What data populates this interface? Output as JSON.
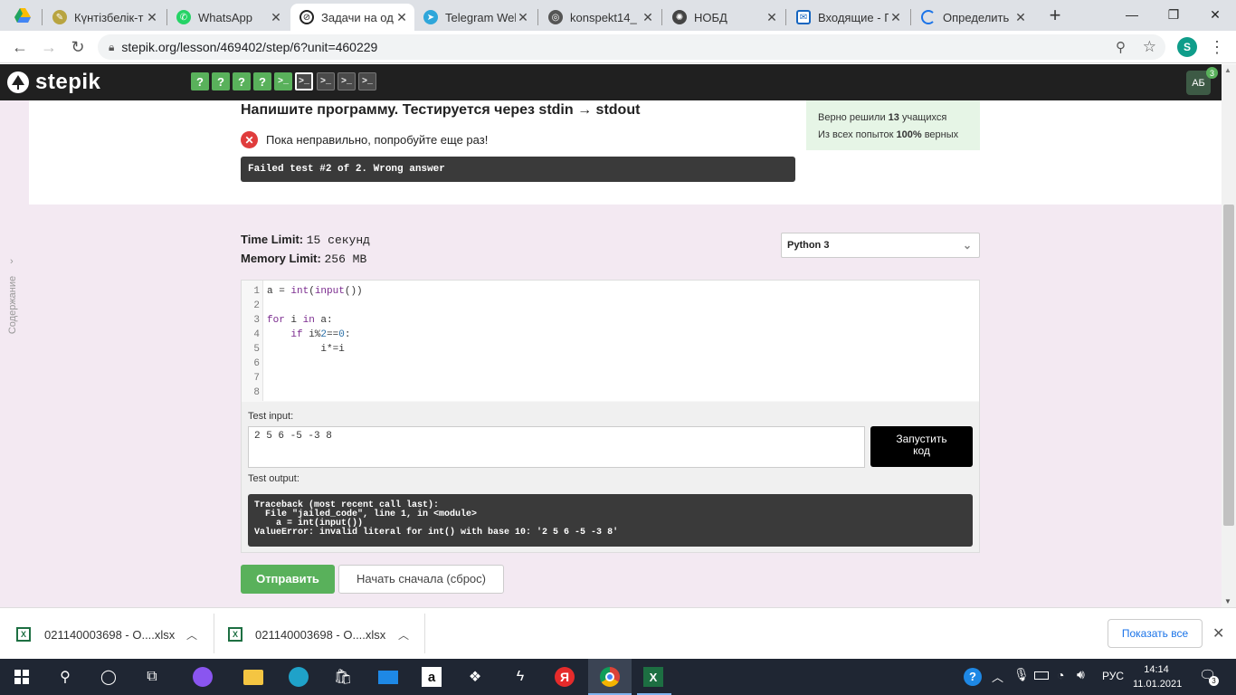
{
  "browser": {
    "tabs": [
      {
        "title": "Күнтізбелік-т",
        "active": false
      },
      {
        "title": "WhatsApp",
        "active": false
      },
      {
        "title": "Задачи на од",
        "active": true
      },
      {
        "title": "Telegram Wel",
        "active": false
      },
      {
        "title": "konspekt14_",
        "active": false
      },
      {
        "title": "НОБД",
        "active": false
      },
      {
        "title": "Входящие - Г",
        "active": false
      },
      {
        "title": "Определить",
        "active": false
      }
    ],
    "url": "stepik.org/lesson/469402/step/6?unit=460229",
    "profile_initial": "S"
  },
  "stepik": {
    "logo": "stepik",
    "steps": [
      "?",
      "?",
      "?",
      "?",
      ">_",
      ">_",
      ">_",
      ">_",
      ">_"
    ],
    "user_initials": "АБ",
    "notification_count": "3"
  },
  "task": {
    "title": "Напишите программу. Тестируется через stdin → stdout",
    "status_message": "Пока неправильно, попробуйте еще раз!",
    "failure_detail": "Failed test #2 of 2. Wrong answer",
    "stats_solved_prefix": "Верно решили ",
    "stats_solved_count": "13",
    "stats_solved_suffix": " учащихся",
    "stats_attempts_prefix": "Из всех попыток ",
    "stats_attempts_percent": "100%",
    "stats_attempts_suffix": " верных",
    "time_limit_label": "Time Limit:",
    "time_limit_value": "15 секунд",
    "memory_limit_label": "Memory Limit:",
    "memory_limit_value": "256 MB",
    "language": "Python 3",
    "sidebar_label": "Содержание"
  },
  "editor": {
    "line_numbers": [
      "1",
      "2",
      "3",
      "4",
      "5",
      "6",
      "7",
      "8"
    ],
    "lines": [
      "a = int(input())",
      "",
      "for i in a:",
      "    if i%2==0:",
      "         i*=i",
      "",
      "",
      ""
    ]
  },
  "runner": {
    "test_input_label": "Test input:",
    "test_input_value": "2 5 6 -5 -3 8",
    "run_button_label": "Запустить код",
    "test_output_label": "Test output:",
    "output_lines": [
      "Traceback (most recent call last):",
      "  File \"jailed_code\", line 1, in <module>",
      "    a = int(input())",
      "ValueError: invalid literal for int() with base 10: '2 5 6 -5 -3 8'"
    ]
  },
  "actions": {
    "submit_label": "Отправить",
    "reset_label": "Начать сначала (сброс)"
  },
  "downloads": {
    "items": [
      "021140003698 - O....xlsx",
      "021140003698 - O....xlsx"
    ],
    "show_all_label": "Показать все"
  },
  "taskbar": {
    "language": "РУС",
    "time": "14:14",
    "date": "11.01.2021"
  },
  "colors": {
    "accent_green": "#59b15b",
    "error_red": "#e03c3c",
    "dark_panel": "#3a3a3a",
    "pink_bg": "#f3e9f2"
  }
}
